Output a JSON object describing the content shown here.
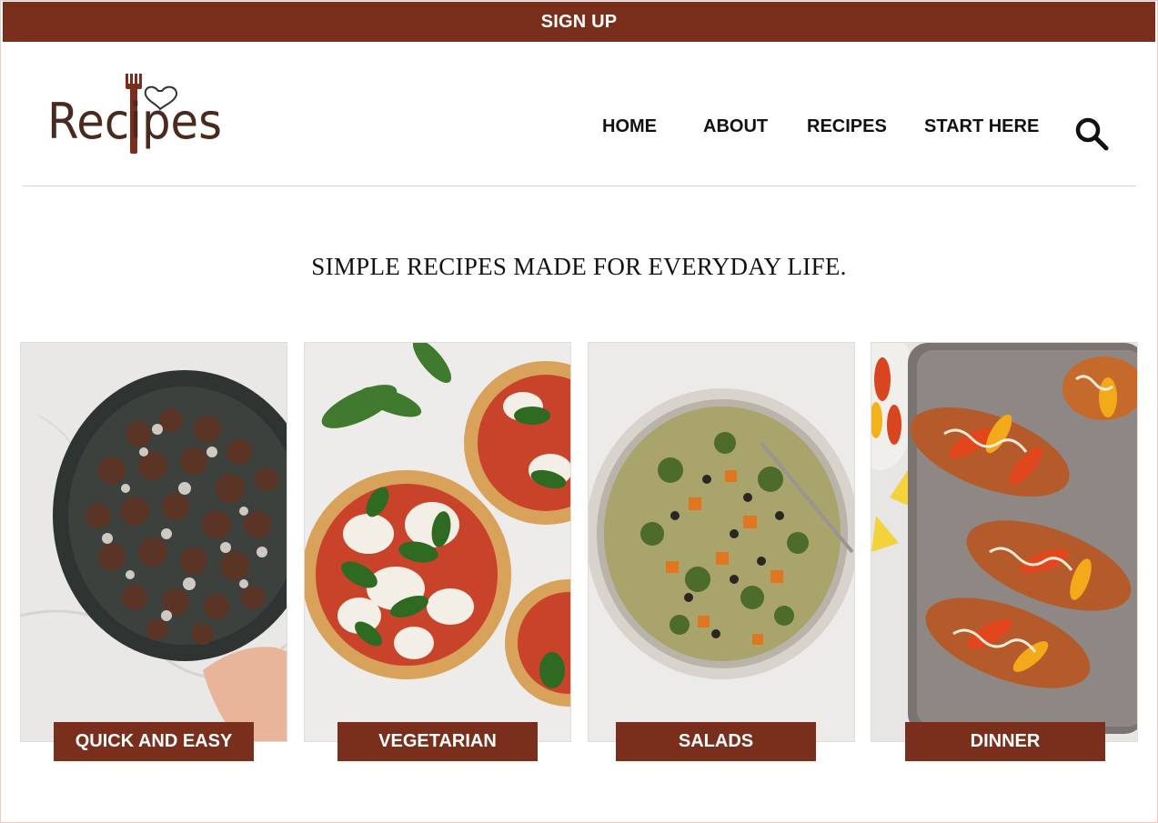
{
  "topbar": {
    "label": "SIGN UP"
  },
  "brand": {
    "logo_text": "Recipes"
  },
  "nav": {
    "items": [
      {
        "label": "HOME"
      },
      {
        "label": "ABOUT"
      },
      {
        "label": "RECIPES"
      },
      {
        "label": "START HERE"
      }
    ]
  },
  "hero": {
    "tagline": "SIMPLE RECIPES MADE FOR EVERYDAY LIFE."
  },
  "categories": [
    {
      "label": "QUICK AND EASY",
      "image": "puppy-chow-bowl"
    },
    {
      "label": "VEGETARIAN",
      "image": "basil-pizza"
    },
    {
      "label": "SALADS",
      "image": "quinoa-salad-bowl"
    },
    {
      "label": "DINNER",
      "image": "sausage-peppers-tray"
    }
  ],
  "colors": {
    "brand": "#7a2f1c",
    "text": "#111111"
  },
  "icons": {
    "search": "search-icon",
    "logo_fork": "fork-icon",
    "logo_heart": "heart-icon"
  }
}
